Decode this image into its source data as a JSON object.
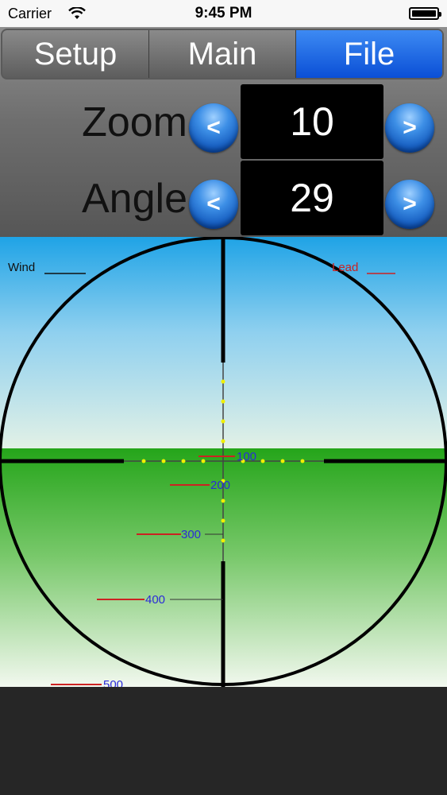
{
  "status_bar": {
    "carrier": "Carrier",
    "time": "9:45 PM"
  },
  "tabs": [
    {
      "label": "Setup",
      "active": false
    },
    {
      "label": "Main",
      "active": false
    },
    {
      "label": "File",
      "active": true
    }
  ],
  "zoom": {
    "label": "Zoom",
    "value": "10",
    "dec": "<",
    "inc": ">"
  },
  "angle": {
    "label": "Angle",
    "value": "29",
    "dec": "<",
    "inc": ">"
  },
  "scope": {
    "wind_label": "Wind",
    "lead_label": "Lead",
    "ranges": [
      "100",
      "200",
      "300",
      "400",
      "500"
    ]
  },
  "colors": {
    "accent": "#1a66e6",
    "sky_top": "#2fa8e8",
    "grass": "#2aa81f",
    "range_text": "#2b2bd8",
    "hold_line": "#cc2222",
    "dots": "#f0f000"
  }
}
